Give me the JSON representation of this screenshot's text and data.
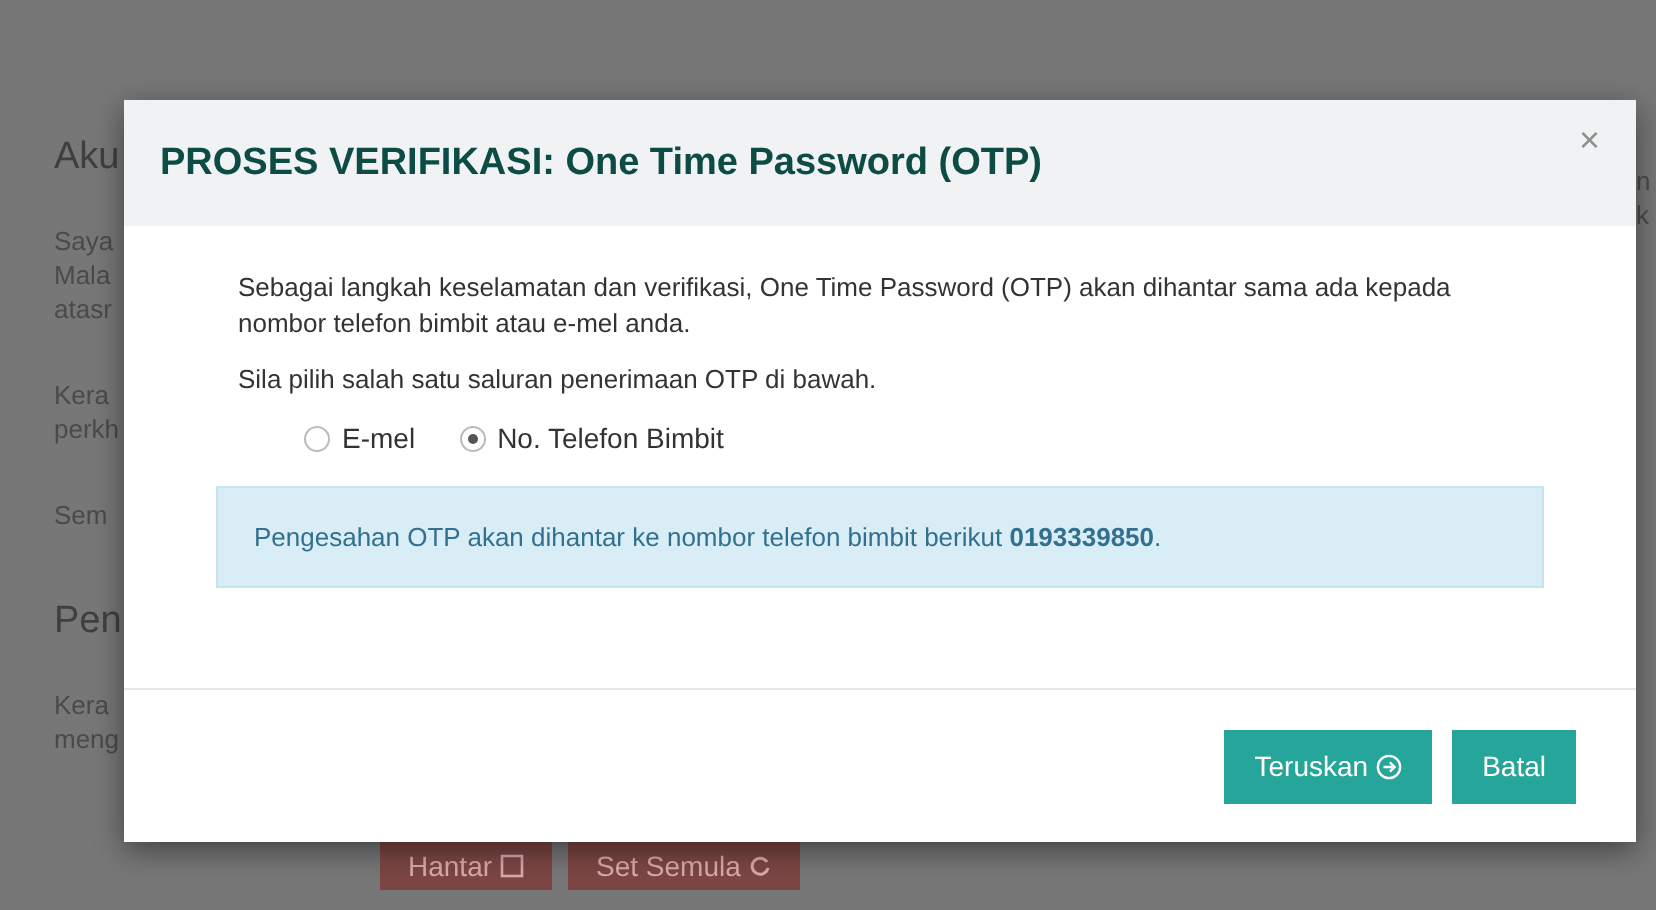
{
  "background_page": {
    "sections": [
      {
        "heading": "Aku",
        "paragraphs": [
          [
            "Saya",
            "Mala",
            "atasr"
          ],
          [
            "Kera",
            "perkh"
          ],
          [
            "Sem"
          ]
        ]
      },
      {
        "heading": "Pen",
        "paragraphs": [
          [
            "Kera",
            "meng"
          ]
        ]
      }
    ],
    "right_fragments": [
      "n",
      "k"
    ],
    "buttons": [
      {
        "label": "Hantar",
        "kind": "submit"
      },
      {
        "label": "Set Semula",
        "kind": "reset"
      }
    ]
  },
  "modal": {
    "title": "PROSES VERIFIKASI: One Time Password (OTP)",
    "close": "×",
    "intro": "Sebagai langkah keselamatan dan verifikasi, One Time Password (OTP) akan dihantar sama ada kepada nombor telefon bimbit atau e-mel anda.",
    "prompt": "Sila pilih salah satu saluran penerimaan OTP di bawah.",
    "channels": [
      {
        "label": "E-mel",
        "selected": false
      },
      {
        "label": "No. Telefon Bimbit",
        "selected": true
      }
    ],
    "notice": "Pengesahan OTP akan dihantar ke nombor telefon bimbit berikut **0193339850**.",
    "buttons": [
      {
        "label": "Teruskan",
        "kind": "next"
      },
      {
        "label": "Batal",
        "kind": "cancel"
      }
    ]
  }
}
